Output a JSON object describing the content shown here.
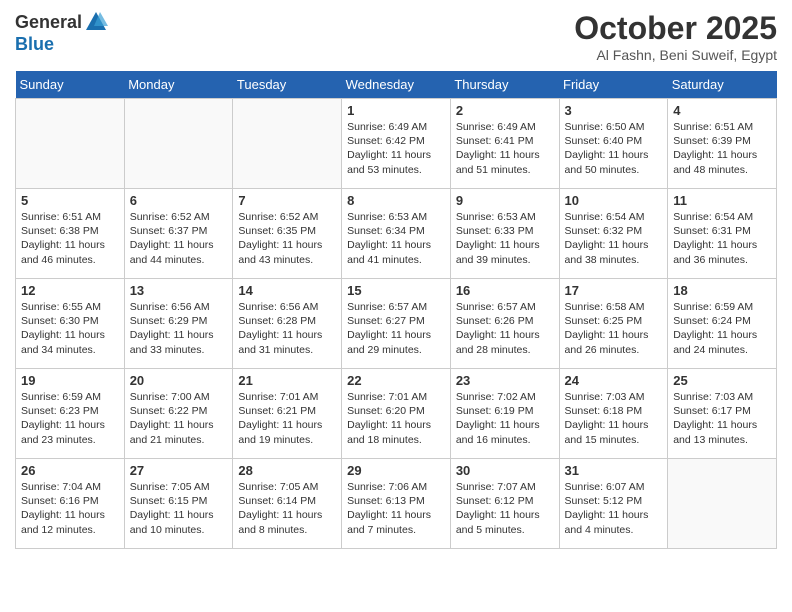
{
  "logo": {
    "general": "General",
    "blue": "Blue"
  },
  "header": {
    "month": "October 2025",
    "location": "Al Fashn, Beni Suweif, Egypt"
  },
  "weekdays": [
    "Sunday",
    "Monday",
    "Tuesday",
    "Wednesday",
    "Thursday",
    "Friday",
    "Saturday"
  ],
  "weeks": [
    [
      {
        "day": "",
        "info": ""
      },
      {
        "day": "",
        "info": ""
      },
      {
        "day": "",
        "info": ""
      },
      {
        "day": "1",
        "info": "Sunrise: 6:49 AM\nSunset: 6:42 PM\nDaylight: 11 hours\nand 53 minutes."
      },
      {
        "day": "2",
        "info": "Sunrise: 6:49 AM\nSunset: 6:41 PM\nDaylight: 11 hours\nand 51 minutes."
      },
      {
        "day": "3",
        "info": "Sunrise: 6:50 AM\nSunset: 6:40 PM\nDaylight: 11 hours\nand 50 minutes."
      },
      {
        "day": "4",
        "info": "Sunrise: 6:51 AM\nSunset: 6:39 PM\nDaylight: 11 hours\nand 48 minutes."
      }
    ],
    [
      {
        "day": "5",
        "info": "Sunrise: 6:51 AM\nSunset: 6:38 PM\nDaylight: 11 hours\nand 46 minutes."
      },
      {
        "day": "6",
        "info": "Sunrise: 6:52 AM\nSunset: 6:37 PM\nDaylight: 11 hours\nand 44 minutes."
      },
      {
        "day": "7",
        "info": "Sunrise: 6:52 AM\nSunset: 6:35 PM\nDaylight: 11 hours\nand 43 minutes."
      },
      {
        "day": "8",
        "info": "Sunrise: 6:53 AM\nSunset: 6:34 PM\nDaylight: 11 hours\nand 41 minutes."
      },
      {
        "day": "9",
        "info": "Sunrise: 6:53 AM\nSunset: 6:33 PM\nDaylight: 11 hours\nand 39 minutes."
      },
      {
        "day": "10",
        "info": "Sunrise: 6:54 AM\nSunset: 6:32 PM\nDaylight: 11 hours\nand 38 minutes."
      },
      {
        "day": "11",
        "info": "Sunrise: 6:54 AM\nSunset: 6:31 PM\nDaylight: 11 hours\nand 36 minutes."
      }
    ],
    [
      {
        "day": "12",
        "info": "Sunrise: 6:55 AM\nSunset: 6:30 PM\nDaylight: 11 hours\nand 34 minutes."
      },
      {
        "day": "13",
        "info": "Sunrise: 6:56 AM\nSunset: 6:29 PM\nDaylight: 11 hours\nand 33 minutes."
      },
      {
        "day": "14",
        "info": "Sunrise: 6:56 AM\nSunset: 6:28 PM\nDaylight: 11 hours\nand 31 minutes."
      },
      {
        "day": "15",
        "info": "Sunrise: 6:57 AM\nSunset: 6:27 PM\nDaylight: 11 hours\nand 29 minutes."
      },
      {
        "day": "16",
        "info": "Sunrise: 6:57 AM\nSunset: 6:26 PM\nDaylight: 11 hours\nand 28 minutes."
      },
      {
        "day": "17",
        "info": "Sunrise: 6:58 AM\nSunset: 6:25 PM\nDaylight: 11 hours\nand 26 minutes."
      },
      {
        "day": "18",
        "info": "Sunrise: 6:59 AM\nSunset: 6:24 PM\nDaylight: 11 hours\nand 24 minutes."
      }
    ],
    [
      {
        "day": "19",
        "info": "Sunrise: 6:59 AM\nSunset: 6:23 PM\nDaylight: 11 hours\nand 23 minutes."
      },
      {
        "day": "20",
        "info": "Sunrise: 7:00 AM\nSunset: 6:22 PM\nDaylight: 11 hours\nand 21 minutes."
      },
      {
        "day": "21",
        "info": "Sunrise: 7:01 AM\nSunset: 6:21 PM\nDaylight: 11 hours\nand 19 minutes."
      },
      {
        "day": "22",
        "info": "Sunrise: 7:01 AM\nSunset: 6:20 PM\nDaylight: 11 hours\nand 18 minutes."
      },
      {
        "day": "23",
        "info": "Sunrise: 7:02 AM\nSunset: 6:19 PM\nDaylight: 11 hours\nand 16 minutes."
      },
      {
        "day": "24",
        "info": "Sunrise: 7:03 AM\nSunset: 6:18 PM\nDaylight: 11 hours\nand 15 minutes."
      },
      {
        "day": "25",
        "info": "Sunrise: 7:03 AM\nSunset: 6:17 PM\nDaylight: 11 hours\nand 13 minutes."
      }
    ],
    [
      {
        "day": "26",
        "info": "Sunrise: 7:04 AM\nSunset: 6:16 PM\nDaylight: 11 hours\nand 12 minutes."
      },
      {
        "day": "27",
        "info": "Sunrise: 7:05 AM\nSunset: 6:15 PM\nDaylight: 11 hours\nand 10 minutes."
      },
      {
        "day": "28",
        "info": "Sunrise: 7:05 AM\nSunset: 6:14 PM\nDaylight: 11 hours\nand 8 minutes."
      },
      {
        "day": "29",
        "info": "Sunrise: 7:06 AM\nSunset: 6:13 PM\nDaylight: 11 hours\nand 7 minutes."
      },
      {
        "day": "30",
        "info": "Sunrise: 7:07 AM\nSunset: 6:12 PM\nDaylight: 11 hours\nand 5 minutes."
      },
      {
        "day": "31",
        "info": "Sunrise: 6:07 AM\nSunset: 5:12 PM\nDaylight: 11 hours\nand 4 minutes."
      },
      {
        "day": "",
        "info": ""
      }
    ]
  ]
}
